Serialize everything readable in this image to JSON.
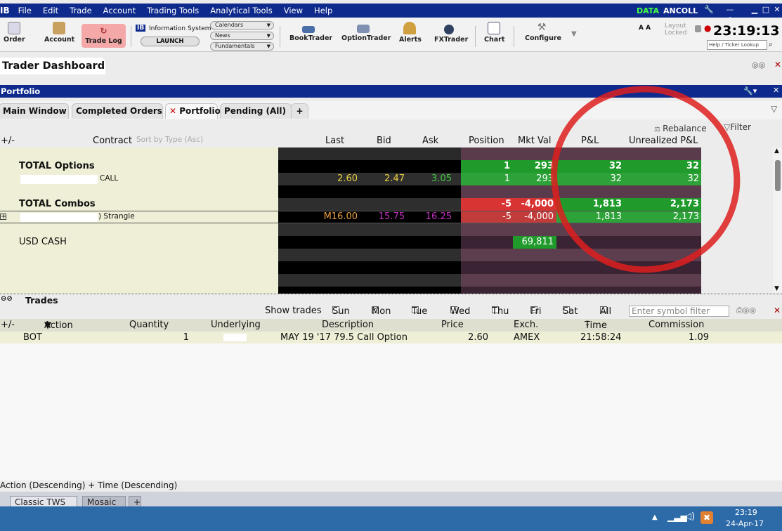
{
  "menubar": {
    "logo": "IB",
    "items": [
      "File",
      "Edit",
      "Trade",
      "Account",
      "Trading Tools",
      "Analytical Tools",
      "View",
      "Help"
    ],
    "data_label": "DATA",
    "user": "ANCOLL"
  },
  "toolbar": {
    "order": "Order",
    "account": "Account",
    "trade_log": "Trade Log",
    "ib_badge": "IB",
    "info_system": "Information System",
    "launch": "LAUNCH",
    "calendars": "Calendars",
    "news": "News",
    "fundamentals": "Fundamentals",
    "booktrader": "BookTrader",
    "optiontrader": "OptionTrader",
    "alerts": "Alerts",
    "fxtrader": "FXTrader",
    "chart": "Chart",
    "configure": "Configure",
    "font_size": "A A",
    "layout_locked_1": "Layout",
    "layout_locked_2": "Locked",
    "clock": "23:19:13",
    "ticker_lookup": "Help / Ticker Lookup"
  },
  "dashboard": {
    "title": "Trader Dashboard"
  },
  "portfolio": {
    "title": "Portfolio",
    "tabs": [
      "Main Window",
      "Completed Orders",
      "Portfolio",
      "Pending (All)",
      "+"
    ],
    "rebalance": "Rebalance",
    "filter": "Filter",
    "columns": {
      "plusminus": "+/-",
      "contract": "Contract",
      "sort_hint": "Sort by Type (Asc)",
      "last": "Last",
      "bid": "Bid",
      "ask": "Ask",
      "position": "Position",
      "mkt_val": "Mkt Val",
      "pnl": "P&L",
      "unrealized": "Unrealized P&L"
    },
    "rows": {
      "total_options": {
        "label": "TOTAL Options",
        "position": "1",
        "mkt_val": "293",
        "pnl": "32",
        "unrealized": "32"
      },
      "option_row": {
        "suffix": "CALL",
        "last": "2.60",
        "bid": "2.47",
        "ask": "3.05",
        "position": "1",
        "mkt_val": "293",
        "pnl": "32",
        "unrealized": "32"
      },
      "total_combos": {
        "label": "TOTAL Combos",
        "position": "-5",
        "mkt_val": "-4,000",
        "pnl": "1,813",
        "unrealized": "2,173"
      },
      "combo_row": {
        "suffix": ") Strangle",
        "last": "M16.00",
        "bid": "15.75",
        "ask": "16.25",
        "position": "-5",
        "mkt_val": "-4,000",
        "pnl": "1,813",
        "unrealized": "2,173"
      },
      "usd_cash": {
        "label": "USD CASH",
        "mkt_val": "69,811"
      }
    }
  },
  "trades": {
    "title": "Trades",
    "show_label": "Show trades",
    "days": [
      "Sun",
      "Mon",
      "Tue",
      "Wed",
      "Thu",
      "Fri",
      "Sat",
      "All"
    ],
    "checked_day": "Mon",
    "filter_placeholder": "Enter symbol filter",
    "columns": {
      "plusminus": "+/-",
      "action": "Action",
      "quantity": "Quantity",
      "underlying": "Underlying",
      "description": "Description",
      "price": "Price",
      "exch": "Exch.",
      "time": "Time",
      "commission": "Commission"
    },
    "row": {
      "action": "BOT",
      "quantity": "1",
      "description": "MAY 19 '17 79.5 Call Option",
      "price": "2.60",
      "exch": "AMEX",
      "time": "21:58:24",
      "commission": "1.09"
    },
    "sort_status": "Action (Descending)  +  Time (Descending)"
  },
  "bottom_tabs": [
    "Classic TWS",
    "Mosaic",
    "+"
  ],
  "taskbar": {
    "time": "23:19",
    "date": "24-Apr-17"
  },
  "colors": {
    "title_bar": "#0e2a8c",
    "positive_cell": "#1f9a2b",
    "negative_cell": "#d83434",
    "last_price": "#e8d040",
    "ask_green": "#44c844",
    "combo_purple": "#c030c0",
    "annotation_circle": "#de1e1e"
  }
}
